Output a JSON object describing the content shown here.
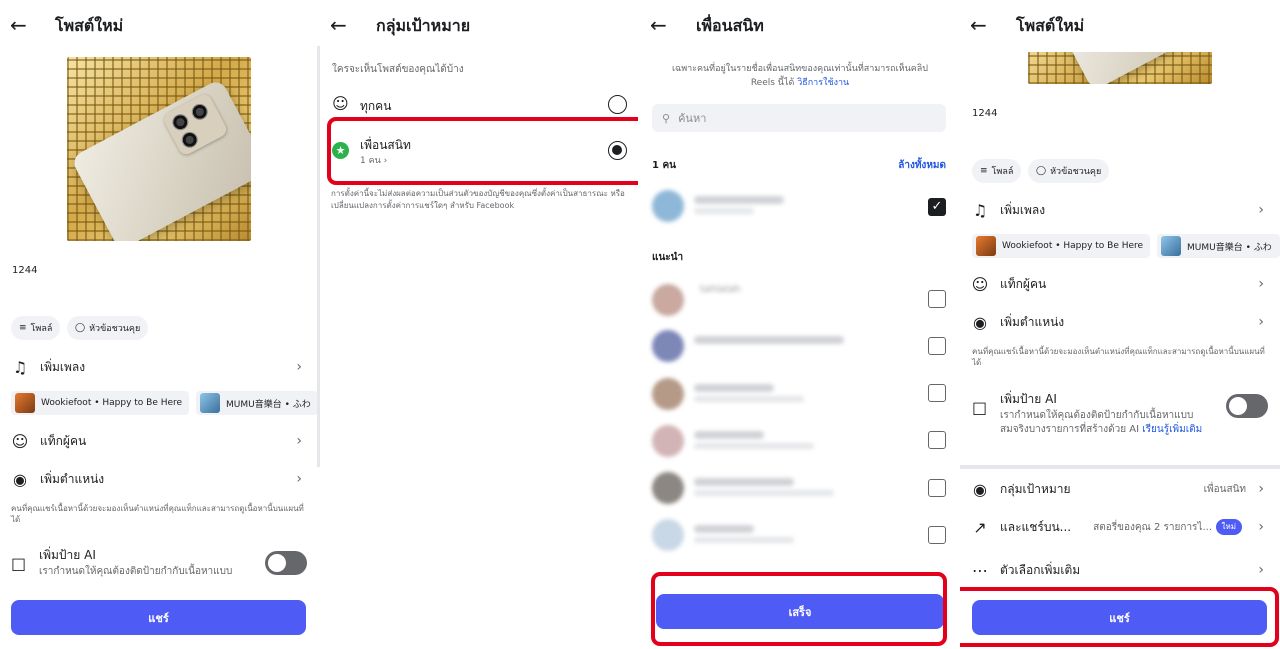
{
  "accent": "#4f5bf5",
  "highlight": "#e3001b",
  "new_post": {
    "title": "โพสต์ใหม่",
    "caption": "1244",
    "chips": {
      "poll": "โพลล์",
      "prompt": "หัวข้อชวนคุย"
    },
    "rows": {
      "add_music": "เพิ่มเพลง",
      "tag_people": "แท็กผู้คน",
      "add_location": "เพิ่มตำแหน่ง"
    },
    "music": [
      {
        "title": "Wookiefoot • Happy to Be Here"
      },
      {
        "title": "MUMU音樂台 • ふわ"
      }
    ],
    "location_note": "คนที่คุณแชร์เนื้อหานี้ด้วยจะมองเห็นตำแหน่งที่คุณแท็กและสามารถดูเนื้อหานี้บนแผนที่ได้",
    "ai_label": {
      "title": "เพิ่มป้าย AI",
      "desc_full": "เรากำหนดให้คุณต้องติดป้ายกำกับเนื้อหาแบบสมจริงบางรายการที่สร้างด้วย AI",
      "desc_partial": "เรากำหนดให้คุณต้องติดป้ายกำกับเนื้อหาแบบ",
      "learn_more": "เรียนรู้เพิ่มเติม",
      "enabled": false
    },
    "audience": {
      "label": "กลุ่มเป้าหมาย",
      "value": "เพื่อนสนิท"
    },
    "share_to": {
      "label": "และแชร์บน...",
      "value": "สตอรี่ของคุณ 2 รายการไ...",
      "badge": "ใหม่"
    },
    "more_options": "ตัวเลือกเพิ่มเติม",
    "share_button": "แชร์"
  },
  "audience_screen": {
    "title": "กลุ่มเป้าหมาย",
    "question": "ใครจะเห็นโพสต์ของคุณได้บ้าง",
    "options": [
      {
        "label": "ทุกคน",
        "sublabel": "",
        "selected": false
      },
      {
        "label": "เพื่อนสนิท",
        "sublabel": "1 คน",
        "selected": true
      }
    ],
    "note": "การตั้งค่านี้จะไม่ส่งผลต่อความเป็นส่วนตัวของบัญชีของคุณซึ่งตั้งค่าเป็นสาธารณะ หรือเปลี่ยนแปลงการตั้งค่าการแชร์ใดๆ สำหรับ Facebook"
  },
  "close_friends": {
    "title": "เพื่อนสนิท",
    "intro": "เฉพาะคนที่อยู่ในรายชื่อเพื่อนสนิทของคุณเท่านั้นที่สามารถเห็นคลิป Reels นี้ได้",
    "intro_link": "วิธีการใช้งาน",
    "search_placeholder": "ค้นหา",
    "selected_count": "1 คน",
    "clear_all": "ล้างทั้งหมด",
    "suggested_heading": "แนะนำ",
    "suggested_name_1": "tahlalah",
    "done_button": "เสร็จ"
  }
}
